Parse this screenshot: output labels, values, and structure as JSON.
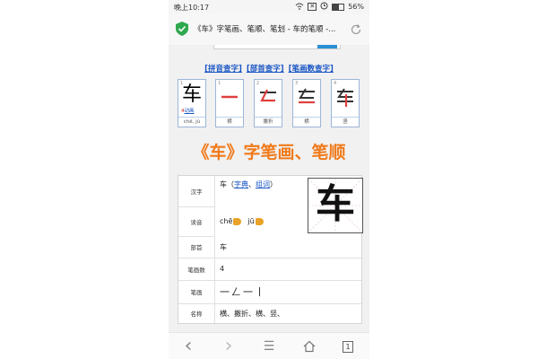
{
  "status_bar": {
    "time": "晚上10:17",
    "battery": "56%",
    "battery_level": 0.56
  },
  "browser": {
    "page_title": "《车》字笔画、笔顺、笔划 - 车的笔顺 -..."
  },
  "page": {
    "links": [
      "[拼音查字]",
      "[部首查字]",
      "[笔画数查字]"
    ],
    "stroke_boxes": [
      {
        "num": "1",
        "glyph": "车",
        "caption": "chē, jū",
        "play_count": "4",
        "play_label": "动画"
      },
      {
        "num": "1",
        "glyph": "一",
        "caption": "横"
      },
      {
        "num": "2",
        "glyph": "𠃋",
        "caption": "撇折"
      },
      {
        "num": "3",
        "glyph": "车",
        "caption": "横"
      },
      {
        "num": "4",
        "glyph": "车",
        "caption": "竖"
      }
    ],
    "heading": "《车》字笔画、笔顺",
    "table": {
      "hanzi_label": "汉字",
      "hanzi_char": "车",
      "hanzi_open": "（",
      "link_dict": "字典",
      "sep": "、",
      "link_word": "组词",
      "hanzi_close": "）",
      "pinyin_label": "读音",
      "pinyin_1": "chē",
      "pinyin_2": "jū",
      "radical_label": "部首",
      "radical": "车",
      "count_label": "笔画数",
      "count": "4",
      "strokes_label": "笔画",
      "strokes_glyphs": "一𠃋一丨",
      "names_label": "名称",
      "names": "横、撇折、横、竖、",
      "big_char": "车"
    }
  },
  "nav": {
    "tab_count": "1",
    "back": "‹",
    "forward": "›",
    "menu": "☰"
  },
  "colors": {
    "heading": "#f07a1a",
    "link": "#1a56c4",
    "stroke_border": "#9cb5d8",
    "speaker": "#e8a227"
  }
}
